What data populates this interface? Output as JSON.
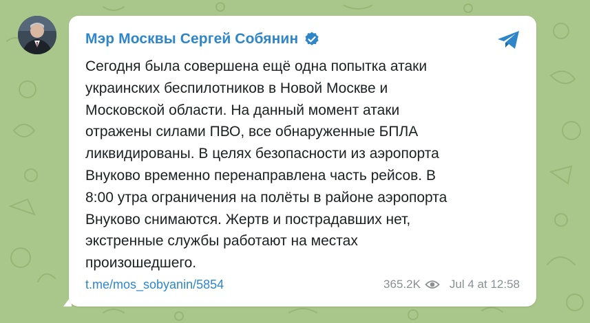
{
  "channel": {
    "name": "Мэр Москвы Сергей Собянин",
    "avatar_icon": "person-avatar",
    "verified_icon": "verified-badge-icon"
  },
  "message": {
    "text": "Сегодня была совершена ещё одна попытка атаки\nукраинских беспилотников в Новой Москве и\nМосковской области. На данный момент атаки\nотражены силами ПВО, все обнаруженные БПЛА\nликвидированы. В целях безопасности из аэропорта\nВнуково временно перенаправлена часть рейсов. В\n8:00 утра ограничения на полёты в районе аэропорта\nВнуково снимаются. Жертв и пострадавших нет,\nэкстренные службы работают на местах\nпроизошедшего."
  },
  "footer": {
    "link": "t.me/mos_sobyanin/5854",
    "views": "365.2K",
    "views_icon": "eye-icon",
    "timestamp": "Jul 4 at 12:58"
  },
  "share_icon": "telegram-plane-icon",
  "colors": {
    "background": "#a9c78a",
    "accent": "#2e86c9",
    "text": "#1d1f21",
    "meta": "#8a8f94"
  }
}
